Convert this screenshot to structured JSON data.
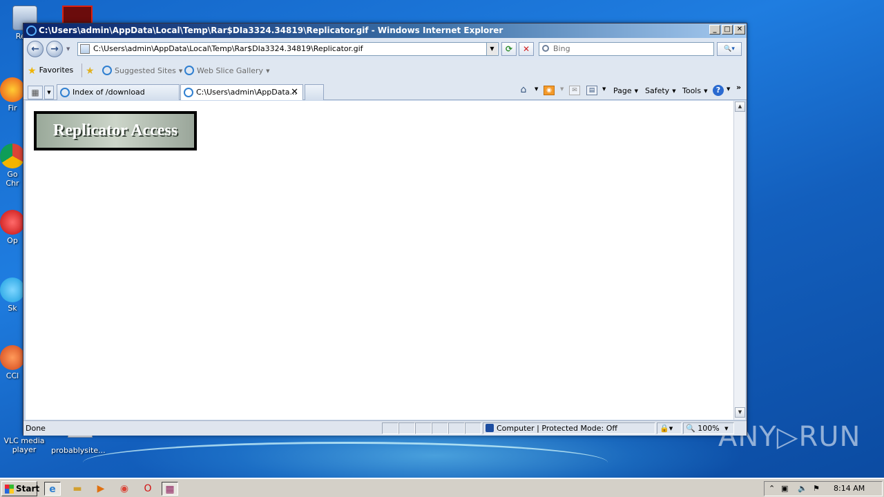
{
  "desktop": {
    "icons": [
      {
        "label": "Recy"
      },
      {
        "label": "Fir"
      },
      {
        "label": "Go Chr"
      },
      {
        "label": "Op"
      },
      {
        "label": "Sk"
      },
      {
        "label": "CCl"
      },
      {
        "label": "VLC media player"
      },
      {
        "label": "probablysite..."
      }
    ],
    "watermark": "ANY▷RUN"
  },
  "window": {
    "title": "C:\\Users\\admin\\AppData\\Local\\Temp\\Rar$DIa3324.34819\\Replicator.gif - Windows Internet Explorer",
    "controls": {
      "minimize": "_",
      "maximize": "□",
      "close": "✕"
    }
  },
  "navbar": {
    "address": "C:\\Users\\admin\\AppData\\Local\\Temp\\Rar$DIa3324.34819\\Replicator.gif",
    "search_placeholder": "Bing"
  },
  "favorites": {
    "favorites_label": "Favorites",
    "suggested_label": "Suggested Sites",
    "webslice_label": "Web Slice Gallery"
  },
  "tabs": [
    {
      "label": "Index of /download"
    },
    {
      "label": "C:\\Users\\admin\\AppData..."
    }
  ],
  "commands": {
    "page": "Page",
    "safety": "Safety",
    "tools": "Tools"
  },
  "content": {
    "image_text": "Replicator Access"
  },
  "statusbar": {
    "status": "Done",
    "zone": "Computer | Protected Mode: Off",
    "zoom": "100%"
  },
  "taskbar": {
    "start_label": "Start",
    "clock": "8:14 AM"
  },
  "colors": {
    "titlebar": "#0a246a",
    "desktop": "#1466c8",
    "replicator_bg": "#ccd5c9"
  }
}
